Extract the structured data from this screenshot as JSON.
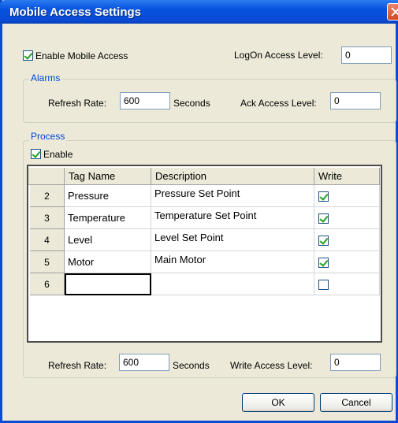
{
  "window": {
    "title": "Mobile Access Settings"
  },
  "top": {
    "enable_label": "Enable Mobile Access",
    "enable_checked": true,
    "logon_label": "LogOn Access Level:",
    "logon_value": "0"
  },
  "alarms": {
    "title": "Alarms",
    "refresh_label": "Refresh Rate:",
    "refresh_value": "600",
    "seconds_label": "Seconds",
    "ack_label": "Ack Access Level:",
    "ack_value": "0"
  },
  "process": {
    "title": "Process",
    "enable_label": "Enable",
    "enable_checked": true,
    "columns": [
      "Tag Name",
      "Description",
      "Write"
    ],
    "rows": [
      {
        "num": "2",
        "tag": "Pressure",
        "desc": "Pressure Set Point",
        "write": true
      },
      {
        "num": "3",
        "tag": "Temperature",
        "desc": "Temperature Set Point",
        "write": true
      },
      {
        "num": "4",
        "tag": "Level",
        "desc": "Level Set Point",
        "write": true
      },
      {
        "num": "5",
        "tag": "Motor",
        "desc": "Main Motor",
        "write": true
      },
      {
        "num": "6",
        "tag": "",
        "desc": "",
        "write": false
      }
    ],
    "refresh_label": "Refresh Rate:",
    "refresh_value": "600",
    "seconds_label": "Seconds",
    "write_label": "Write Access Level:",
    "write_value": "0"
  },
  "buttons": {
    "ok": "OK",
    "cancel": "Cancel"
  }
}
